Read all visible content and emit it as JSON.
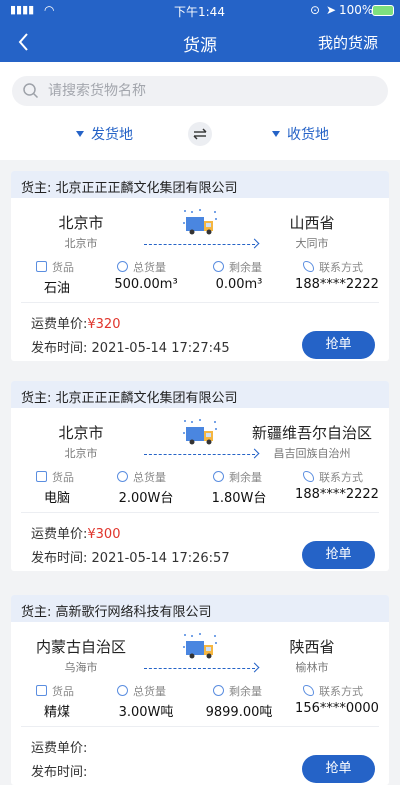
{
  "status_bar": {
    "time": "下午1:44",
    "battery": "100%"
  },
  "nav": {
    "title": "货源",
    "right_action": "我的货源"
  },
  "search": {
    "placeholder": "请搜索货物名称"
  },
  "filters": {
    "origin": "发货地",
    "destination": "收货地"
  },
  "labels": {
    "goods": "货品",
    "total": "总货量",
    "remaining": "剩余量",
    "contact": "联系方式",
    "freight_price": "运费单价:",
    "publish_time": "发布时间:",
    "grab_button": "抢单"
  },
  "cards": [
    {
      "owner": "货主: 北京正正正麟文化集团有限公司",
      "from_city": "北京市",
      "from_sub": "北京市",
      "to_city": "山西省",
      "to_sub": "大同市",
      "goods": "石油",
      "total": "500.00m³",
      "remaining": "0.00m³",
      "contact": "188****2222",
      "price": "¥320",
      "time": "2021-05-14 17:27:45"
    },
    {
      "owner": "货主: 北京正正正麟文化集团有限公司",
      "from_city": "北京市",
      "from_sub": "北京市",
      "to_city": "新疆维吾尔自治区",
      "to_sub": "昌吉回族自治州",
      "goods": "电脑",
      "total": "2.00W台",
      "remaining": "1.80W台",
      "contact": "188****2222",
      "price": "¥300",
      "time": "2021-05-14 17:26:57"
    },
    {
      "owner": "货主: 高新歌行网络科技有限公司",
      "from_city": "内蒙古自治区",
      "from_sub": "乌海市",
      "to_city": "陕西省",
      "to_sub": "榆林市",
      "goods": "精煤",
      "total": "3.00W吨",
      "remaining": "9899.00吨",
      "contact": "156****0000",
      "price": "",
      "time": ""
    }
  ],
  "colors": {
    "primary": "#2563c7",
    "price": "#e0342b",
    "owner_bg": "#e8eef9"
  }
}
